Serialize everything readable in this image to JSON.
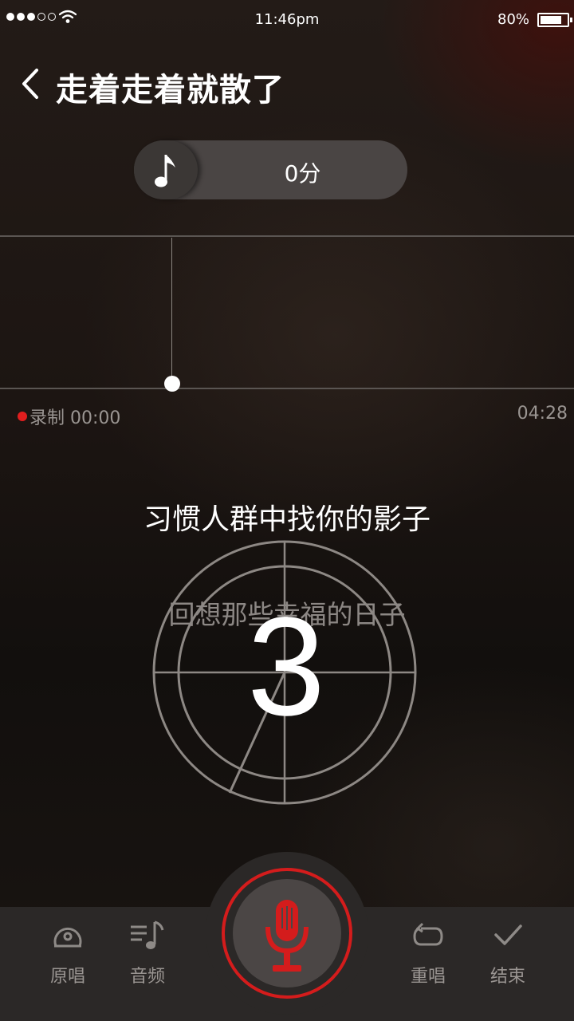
{
  "status_bar": {
    "time": "11:46pm",
    "battery_percent": "80%",
    "battery_level": 0.8,
    "signal_bars_filled": 3,
    "signal_bars_total": 5
  },
  "header": {
    "title": "走着走着就散了",
    "back_icon": "chevron-left-icon"
  },
  "score_pill": {
    "icon": "music-note-icon",
    "score": "0分"
  },
  "recording": {
    "label": "录制 00:00",
    "total_time": "04:28",
    "indicator_color": "#e01e1e"
  },
  "lyrics": {
    "current": "习惯人群中找你的影子",
    "next": "回想那些幸福的日子"
  },
  "countdown": {
    "number": "3"
  },
  "bottom_bar": {
    "left_tabs": [
      {
        "label": "原唱",
        "icon": "disc-icon"
      },
      {
        "label": "音频",
        "icon": "playlist-music-icon"
      }
    ],
    "right_tabs": [
      {
        "label": "重唱",
        "icon": "repeat-icon"
      },
      {
        "label": "结束",
        "icon": "checkmark-icon"
      }
    ],
    "record_button_icon": "microphone-icon",
    "accent_color": "#d41c1c"
  }
}
